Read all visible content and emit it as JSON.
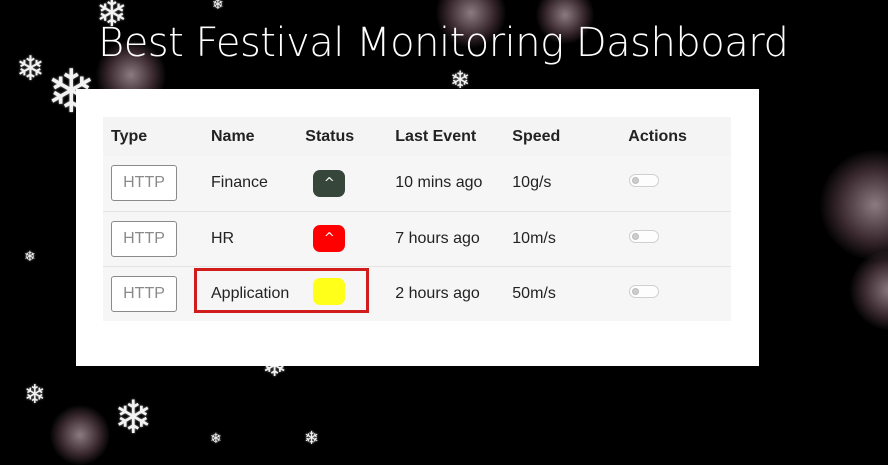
{
  "dashboard": {
    "title": "Best Festival Monitoring Dashboard"
  },
  "table": {
    "headers": {
      "type": "Type",
      "name": "Name",
      "status": "Status",
      "last_event": "Last Event",
      "speed": "Speed",
      "actions": "Actions"
    },
    "rows": [
      {
        "type": "HTTP",
        "name": "Finance",
        "status_symbol": "^",
        "status_color": "#37463b",
        "status_text_color": "#ffffff",
        "last_event": "10 mins ago",
        "speed": "10g/s",
        "toggle_on": false
      },
      {
        "type": "HTTP",
        "name": "HR",
        "status_symbol": "^",
        "status_color": "#ff0000",
        "status_text_color": "#ffffff",
        "last_event": "7 hours ago",
        "speed": "10m/s",
        "toggle_on": false
      },
      {
        "type": "HTTP",
        "name": "Application",
        "status_symbol": "",
        "status_color": "#ffff1a",
        "status_text_color": "#ffffff",
        "last_event": "2 hours ago",
        "speed": "50m/s",
        "toggle_on": false
      }
    ]
  },
  "annotation": {
    "highlight_color": "#d11c1c"
  },
  "background": {
    "color": "#000000",
    "decoration_icon": "snowflake-icon"
  }
}
